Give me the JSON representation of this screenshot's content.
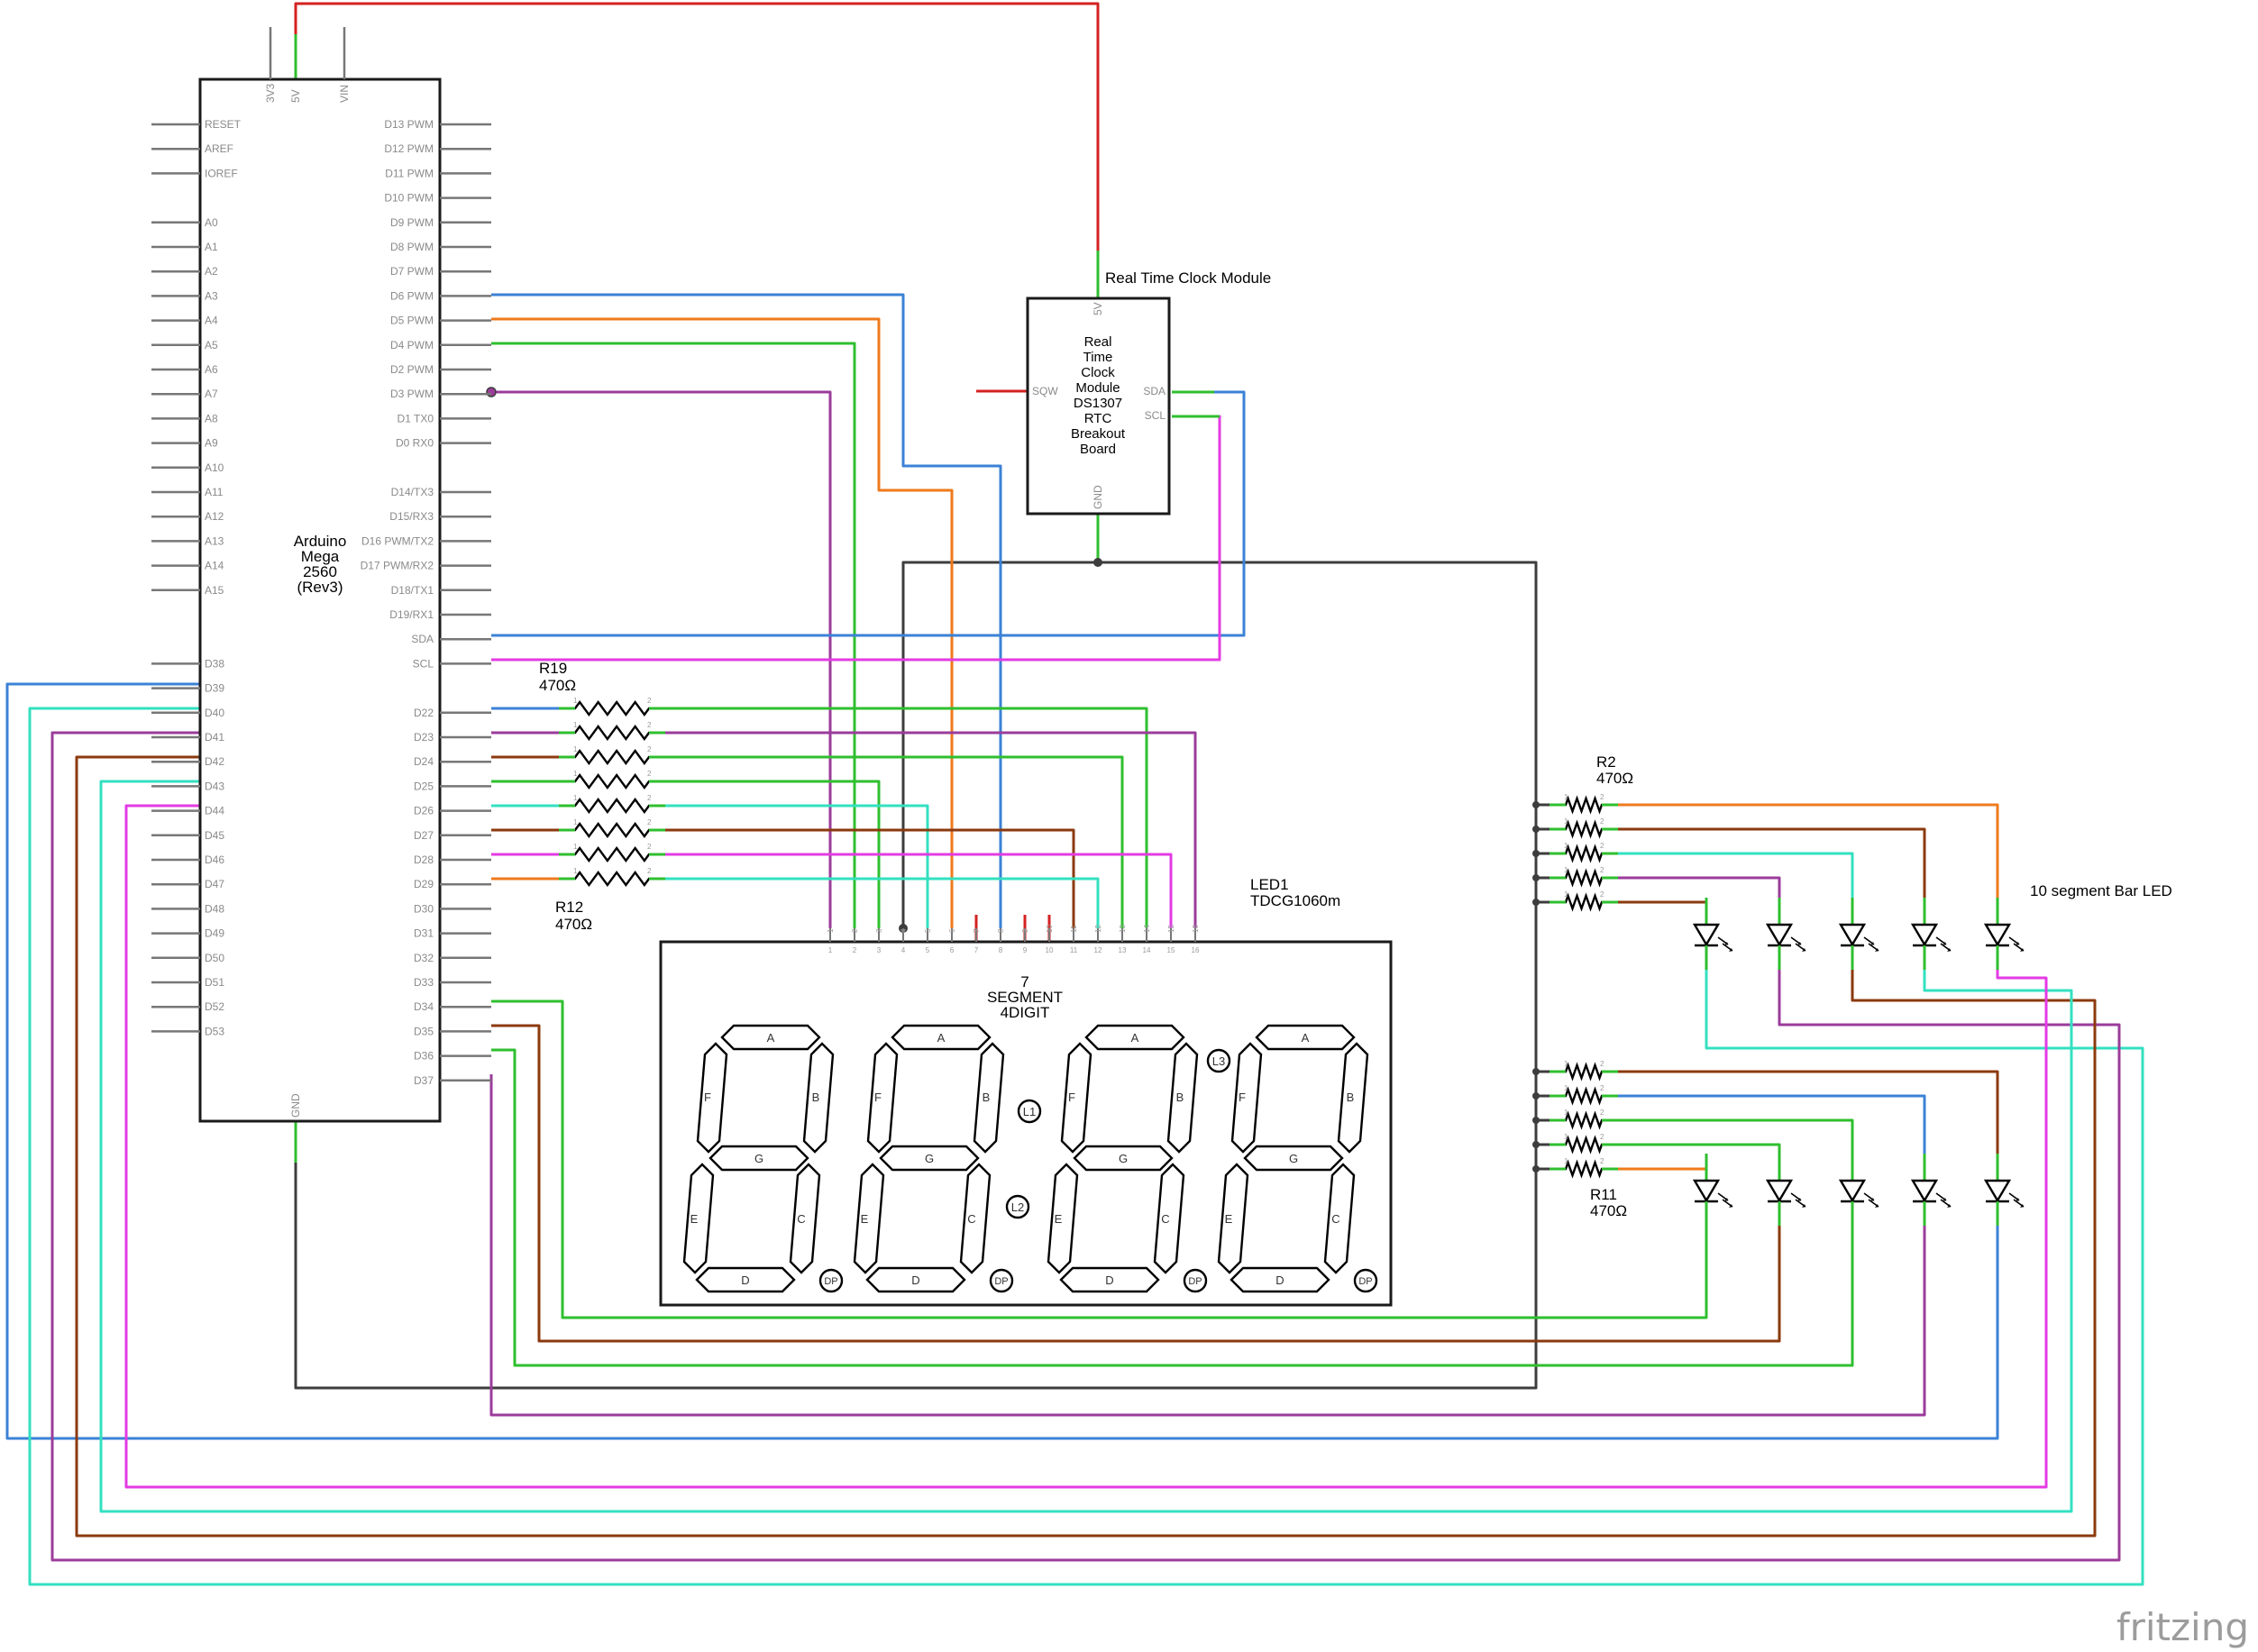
{
  "title": "Arduino Mega 2560 (Rev3)",
  "arduino": {
    "name": [
      "Arduino",
      "Mega",
      "2560",
      "(Rev3)"
    ],
    "top_pins": [
      "3V3",
      "5V",
      "VIN"
    ],
    "left_pins": [
      "RESET",
      "AREF",
      "IOREF",
      "",
      "A0",
      "A1",
      "A2",
      "A3",
      "A4",
      "A5",
      "A6",
      "A7",
      "A8",
      "A9",
      "A10",
      "A11",
      "A12",
      "A13",
      "A14",
      "A15",
      "",
      "",
      "D38",
      "D39",
      "D40",
      "D41",
      "D42",
      "D43",
      "D44",
      "D45",
      "D46",
      "D47",
      "D48",
      "D49",
      "D50",
      "D51",
      "D52",
      "D53"
    ],
    "right_pins": [
      "D13 PWM",
      "D12 PWM",
      "D11 PWM",
      "D10 PWM",
      "D9 PWM",
      "D8 PWM",
      "D7 PWM",
      "D6 PWM",
      "D5 PWM",
      "D4 PWM",
      "D2 PWM",
      "D3 PWM",
      "D1 TX0",
      "D0 RX0",
      "",
      "D14/TX3",
      "D15/RX3",
      "D16 PWM/TX2",
      "D17 PWM/RX2",
      "D18/TX1",
      "D19/RX1",
      "SDA",
      "SCL",
      "",
      "D22",
      "D23",
      "D24",
      "D25",
      "D26",
      "D27",
      "D28",
      "D29",
      "D30",
      "D31",
      "D32",
      "D33",
      "D34",
      "D35",
      "D36",
      "D37"
    ],
    "bottom_pin": "GND"
  },
  "rtc": {
    "title": "Real Time Clock Module",
    "body": [
      "Real",
      "Time",
      "Clock",
      "Module",
      "DS1307",
      "RTC",
      "Breakout",
      "Board"
    ],
    "pins": {
      "top": "5V",
      "left": "SQW",
      "sda": "SDA",
      "scl": "SCL",
      "bottom": "GND"
    }
  },
  "display": {
    "label": [
      "LED1",
      "TDCG1060m"
    ],
    "body": [
      "7",
      "SEGMENT",
      "4DIGIT"
    ],
    "pin_numbers": [
      "1",
      "2",
      "3",
      "4",
      "5",
      "6",
      "7",
      "8",
      "9",
      "10",
      "11",
      "12",
      "13",
      "14",
      "15",
      "16"
    ],
    "segments": [
      "A",
      "B",
      "C",
      "D",
      "E",
      "F",
      "G"
    ],
    "dp": "DP",
    "colon": [
      "L1",
      "L2",
      "L3"
    ]
  },
  "resistor_labels": {
    "r19": [
      "R19",
      "470Ω"
    ],
    "r12": [
      "R12",
      "470Ω"
    ],
    "r2": [
      "R2",
      "470Ω"
    ],
    "r11": [
      "R11",
      "470Ω"
    ]
  },
  "bar_led": {
    "label": "10 segment Bar LED"
  },
  "watermark": "fritzing",
  "colors": {
    "red": "#d42222",
    "green": "#2fbf2f",
    "blue": "#3b82d6",
    "orange": "#ef7a1c",
    "purple": "#9b3c9b",
    "magenta": "#e33be3",
    "cyan": "#33e0c0",
    "brown": "#8b3a0e",
    "black": "#3d3d3d"
  }
}
